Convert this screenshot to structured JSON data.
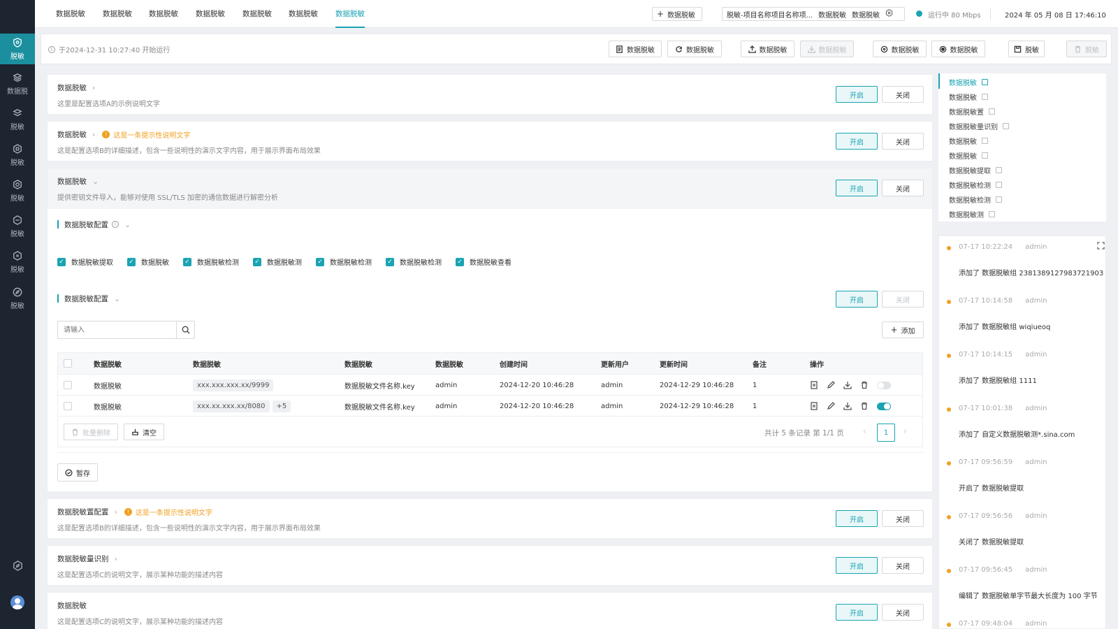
{
  "sidebar": {
    "items": [
      {
        "label": "脱敏",
        "icon": "shield-icon",
        "active": true
      },
      {
        "label": "数据脱",
        "icon": "layers-icon"
      },
      {
        "label": "脱敏",
        "icon": "stack-icon"
      },
      {
        "label": "脱敏",
        "icon": "hexagon-icon"
      },
      {
        "label": "脱敏",
        "icon": "target-icon"
      },
      {
        "label": "脱敏",
        "icon": "cube-icon"
      },
      {
        "label": "脱敏",
        "icon": "hex-settings-icon"
      },
      {
        "label": "脱敏",
        "icon": "compass-icon"
      }
    ]
  },
  "topbar": {
    "tabs": [
      "数据脱敏",
      "数据脱敏",
      "数据脱敏",
      "数据脱敏",
      "数据脱敏",
      "数据脱敏",
      "数据脱敏"
    ],
    "add_button": "数据脱敏",
    "project": "脱敏-项目名称项目名称项...",
    "project_a": "数据脱敏",
    "project_b": "数据脱敏",
    "status": "运行中 80 Mbps",
    "datetime": "2024 年 05 月 08 日 17:46:10"
  },
  "toolbar": {
    "run_info": "于2024-12-31 10:27:40 开始运行",
    "buttons": [
      "数据脱敏",
      "数据脱敏",
      "数据脱敏",
      "数据脱敏",
      "数据脱敏",
      "数据脱敏",
      "脱敏",
      "脱敏"
    ]
  },
  "settings": [
    {
      "title": "数据脱敏",
      "desc": "这里是配置选项A的示例说明文字",
      "on": "开启",
      "off": "关闭"
    },
    {
      "title": "数据脱敏",
      "hint": "这是一条提示性说明文字",
      "desc": "这是配置选项B的详细描述，包含一些说明性的演示文字内容，用于展示界面布局效果",
      "on": "开启",
      "off": "关闭"
    },
    {
      "title": "数据脱敏",
      "desc": "提供密钥文件导入，能够对使用 SSL/TLS 加密的通信数据进行解密分析",
      "on": "开启",
      "off": "关闭"
    },
    {
      "title": "数据脱敏置配置",
      "hint": "这是一条提示性说明文字",
      "desc": "这是配置选项B的详细描述，包含一些说明性的演示文字内容，用于展示界面布局效果",
      "on": "开启",
      "off": "关闭"
    },
    {
      "title": "数据脱敏量识别",
      "desc": "这是配置选项C的说明文字，展示某种功能的描述内容",
      "on": "开启",
      "off": "关闭"
    },
    {
      "title": "数据脱敏",
      "desc": "这是配置选项C的说明文字，展示某种功能的描述内容",
      "on": "开启",
      "off": "关闭"
    }
  ],
  "config": {
    "label": "数据脱敏配置",
    "checkboxes": [
      "数据脱敏提取",
      "数据脱敏",
      "数据脱敏检测",
      "数据脱敏测",
      "数据脱敏检测",
      "数据脱敏检测",
      "数据脱敏查看"
    ]
  },
  "config2": {
    "label": "数据脱敏配置",
    "on": "开启",
    "off": "关闭"
  },
  "search": {
    "placeholder": "请输入",
    "add": "添加"
  },
  "table": {
    "headers": [
      "数据脱敏",
      "数据脱敏",
      "数据脱敏",
      "数据脱敏",
      "创建时间",
      "更新用户",
      "更新时间",
      "备注",
      "操作"
    ],
    "rows": [
      {
        "c1": "数据脱敏",
        "c2": "xxx.xxx.xxx.xx/9999",
        "c3": "数据脱敏文件名称.key",
        "c4": "admin",
        "created": "2024-12-20 10:46:28",
        "user": "admin",
        "updated": "2024-12-29 10:46:28",
        "note": "1",
        "enabled": false
      },
      {
        "c1": "数据脱敏",
        "c2": "xxx.xx.xxx.xx/8080",
        "extra": "+5",
        "c3": "数据脱敏文件名称.key",
        "c4": "admin",
        "created": "2024-12-20 10:46:28",
        "user": "admin",
        "updated": "2024-12-29 10:46:28",
        "note": "1",
        "enabled": true
      }
    ],
    "batch_delete": "批量删除",
    "clear": "清空",
    "pagination": "共计 5 条记录 第 1/1 页",
    "page": "1"
  },
  "save": "暂存",
  "right_nav": [
    "数据脱敏",
    "数据脱敏",
    "数据脱敏置",
    "数据脱敏量识别",
    "数据脱敏",
    "数据脱敏",
    "数据脱敏提取",
    "数据脱敏检测",
    "数据脱敏检测",
    "数据脱敏测"
  ],
  "timeline": [
    {
      "time": "07-17 10:22:24",
      "user": "admin",
      "text": "添加了 数据脱敏组 2381389127983721903"
    },
    {
      "time": "07-17 10:14:58",
      "user": "admin",
      "text": "添加了 数据脱敏组 wiqiueoq"
    },
    {
      "time": "07-17 10:14:15",
      "user": "admin",
      "text": "添加了 数据脱敏组 1111"
    },
    {
      "time": "07-17 10:01:38",
      "user": "admin",
      "text": "添加了 自定义数据脱敏测*.sina.com"
    },
    {
      "time": "07-17 09:56:59",
      "user": "admin",
      "text": "开启了 数据脱敏提取"
    },
    {
      "time": "07-17 09:56:56",
      "user": "admin",
      "text": "关闭了 数据脱敏提取"
    },
    {
      "time": "07-17 09:56:45",
      "user": "admin",
      "text": "编辑了 数据脱敏单字节最大长度为 100 字节"
    },
    {
      "time": "07-17 09:48:04",
      "user": "admin",
      "text": ""
    }
  ],
  "colors": {
    "accent": "#1aa3b3",
    "sidebar": "#1d2530",
    "warning": "#f0a020"
  }
}
